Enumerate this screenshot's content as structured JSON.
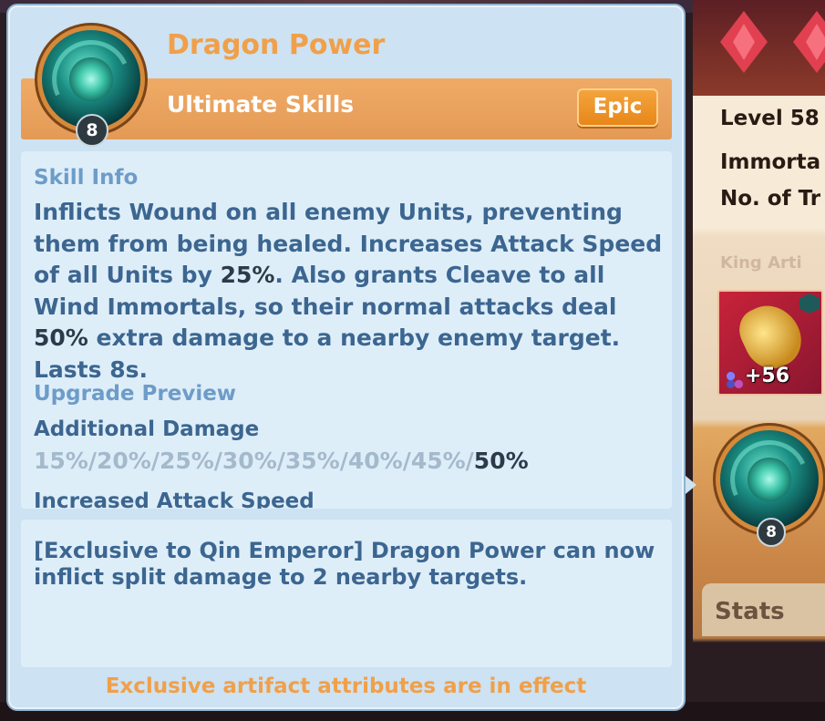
{
  "skill": {
    "name": "Dragon Power",
    "type": "Ultimate Skills",
    "rarity": "Epic",
    "level": "8",
    "icon": "dragon-orb-icon"
  },
  "skill_info": {
    "heading": "Skill Info",
    "description": {
      "p1": "Inflicts Wound on all enemy Units, preventing them from being healed. Increases Attack Speed of all Units by ",
      "v1": "25%",
      "p2": ". Also grants Cleave to all Wind Immortals, so their normal attacks deal ",
      "v2": "50%",
      "p3": " extra damage to a nearby enemy target. Lasts 8s."
    }
  },
  "upgrade_preview": {
    "heading": "Upgrade Preview",
    "stats": [
      {
        "name": "Additional Damage",
        "previous_levels": "15%/20%/25%/30%/35%/40%/45%/",
        "current_level": "50%"
      },
      {
        "name": "Increased Attack Speed"
      }
    ]
  },
  "exclusive": {
    "text": "[Exclusive to Qin Emperor] Dragon Power can now inflict split damage to 2 nearby targets.",
    "footer": "Exclusive artifact attributes are in effect"
  },
  "background_panel": {
    "level_label": "Level 58",
    "line2": "Immorta",
    "line3": "No. of Tr",
    "faded_text": "King Arti",
    "artifact_bonus": "+56",
    "skill_level": "8",
    "stats_tab": "Stats"
  },
  "colors": {
    "accent_orange": "#f0a04a",
    "header_band": "#e8a05c",
    "text_blue": "#3c6690",
    "heading_blue": "#6e9cc8",
    "highlight_dark": "#2c3a4a",
    "panel_bg": "#cde2f2"
  }
}
